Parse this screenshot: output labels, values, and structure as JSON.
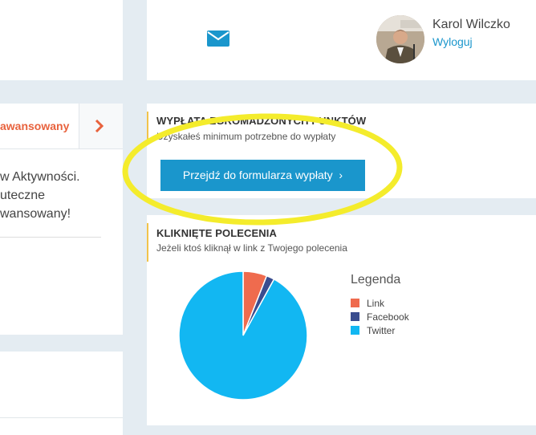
{
  "header": {
    "mail_icon": "envelope-icon",
    "user_name": "Karol Wilczko",
    "logout_label": "Wyloguj"
  },
  "left_panel": {
    "tab_label": "awansowany",
    "text_lines": [
      "w Aktywności.",
      "uteczne",
      "wansowany!"
    ]
  },
  "payout": {
    "title": "WYPŁATA ZGROMADZONYCH PUNKTÓW",
    "subtitle": "Uzyskałeś minimum potrzebne do wypłaty",
    "button_label": "Przejdź do formularza wypłaty",
    "button_arrow": "›"
  },
  "referrals": {
    "title": "KLIKNIĘTE POLECENIA",
    "subtitle": "Jeżeli ktoś kliknął w link z Twojego polecenia"
  },
  "chart_data": {
    "type": "pie",
    "legend_title": "Legenda",
    "legend_position": "right",
    "categories": [
      "Link",
      "Facebook",
      "Twitter"
    ],
    "values": [
      6,
      2,
      92
    ],
    "colors": [
      "#ef6b4e",
      "#3a4d8f",
      "#12b7f2"
    ]
  },
  "colors": {
    "accent": "#1a96cc",
    "highlight": "#f4ec2c",
    "card_accent": "#f1c34a"
  }
}
